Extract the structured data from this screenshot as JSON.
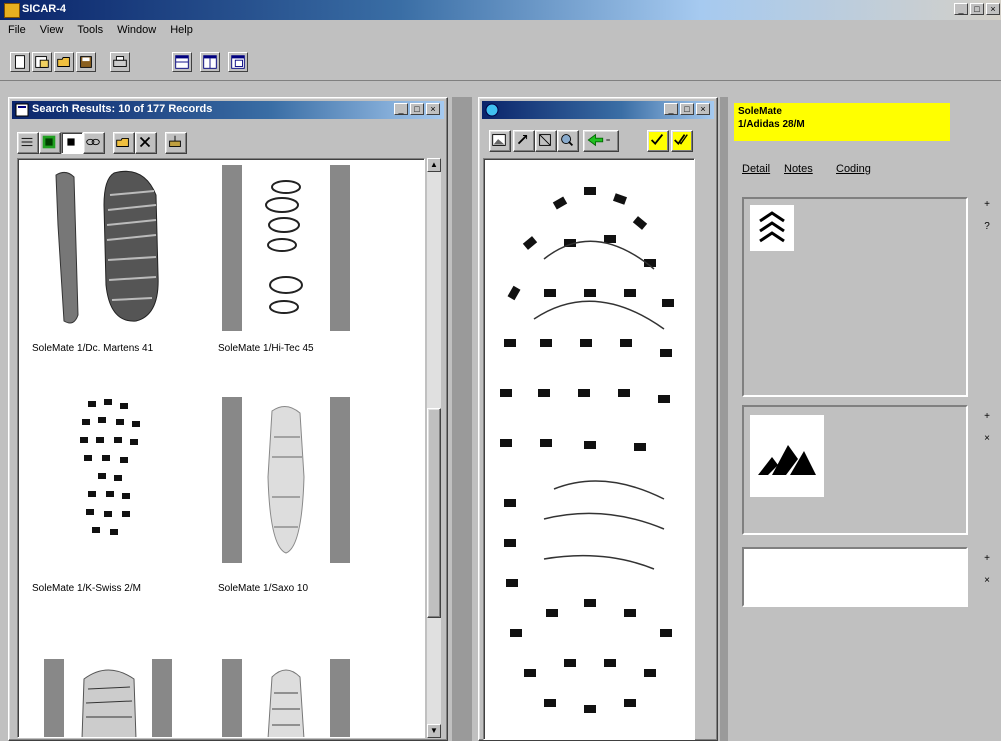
{
  "app": {
    "title": "SICAR-4",
    "window_buttons": [
      "_",
      "□",
      "×"
    ]
  },
  "menu": [
    "File",
    "View",
    "Tools",
    "Window",
    "Help"
  ],
  "results": {
    "title": "Search Results: 10 of 177 Records",
    "captions": [
      "SoleMate 1/Dc. Martens 41",
      "SoleMate 1/Hi-Tec 45",
      "SoleMate 1/K-Swiss 2/M",
      "SoleMate 1/Saxo 10"
    ]
  },
  "viewer": {
    "title": ""
  },
  "info": {
    "line1": "SoleMate",
    "line2": "1/Adidas 28/M",
    "tabs": [
      "Detail",
      "Notes",
      "Coding"
    ],
    "side_buttons": [
      "+",
      "?",
      "+",
      "×",
      "+",
      "×"
    ]
  },
  "colors": {
    "title_blue": "#0a246a",
    "highlight_yellow": "#ffff00",
    "bg_gray": "#c0c0c0"
  },
  "icons": {
    "toolbar": [
      "new-icon",
      "open-icon",
      "folder-icon",
      "save-icon",
      "print-icon",
      "tile-horizontal-icon",
      "tile-vertical-icon",
      "cascade-icon"
    ],
    "results_toolbar": [
      "list-view-icon",
      "thumbnail-view-icon",
      "stop-icon",
      "link-icon",
      "import-icon",
      "delete-icon",
      "export-icon"
    ],
    "viewer_toolbar": [
      "image-icon",
      "rotate-icon",
      "zoom-fit-icon",
      "zoom-icon",
      "back-arrow-icon",
      "check-icon",
      "double-check-icon"
    ]
  }
}
